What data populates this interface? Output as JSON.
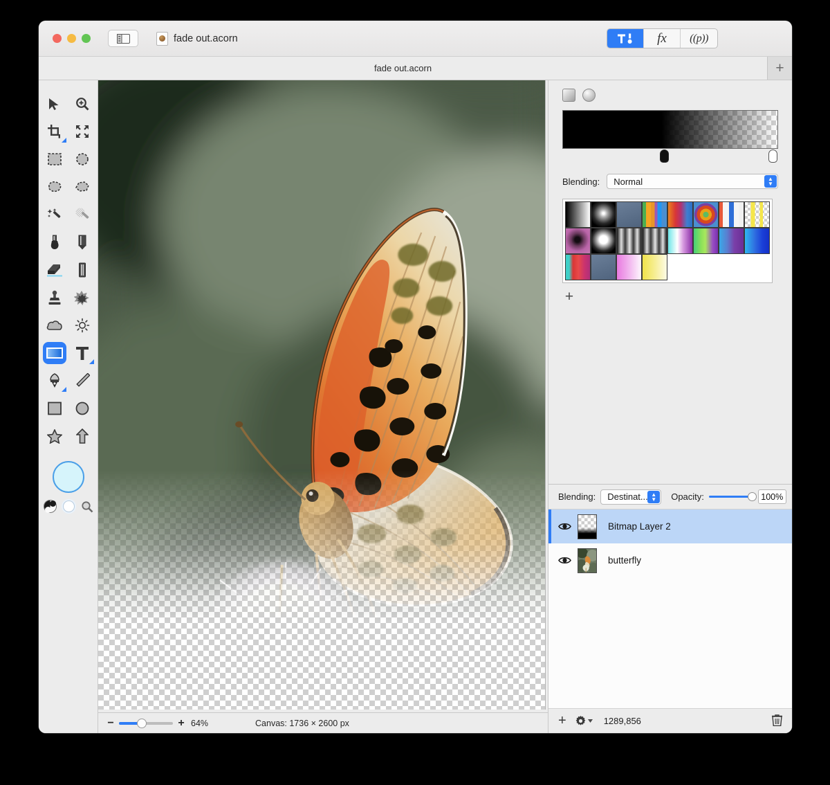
{
  "window": {
    "title": "fade out.acorn",
    "doc_icon": "acorn-document-icon",
    "traffic_lights": [
      "close",
      "minimize",
      "zoom"
    ]
  },
  "titlebar": {
    "sidebar_toggle_icon": "sidebar-toggle-icon",
    "buttons": [
      {
        "name": "tools-palette-button",
        "label": "",
        "icon": "hammer-brush-icon",
        "active": true
      },
      {
        "name": "filters-button",
        "label": "fx",
        "icon": "fx-icon",
        "active": false
      },
      {
        "name": "presets-button",
        "label": "((p))",
        "icon": "presets-icon",
        "active": false
      }
    ]
  },
  "tabbar": {
    "tab_label": "fade out.acorn",
    "new_tab_label": "+"
  },
  "tools": {
    "items": [
      {
        "name": "move-tool",
        "icon": "arrow-cursor-icon",
        "selected": false
      },
      {
        "name": "zoom-tool",
        "icon": "magnifier-plus-icon",
        "selected": false
      },
      {
        "name": "crop-tool",
        "icon": "crop-icon",
        "selected": false,
        "has_submenu": true
      },
      {
        "name": "transform-tool",
        "icon": "move-arrows-icon",
        "selected": false
      },
      {
        "name": "rectangle-select-tool",
        "icon": "dashed-rectangle-icon",
        "selected": false
      },
      {
        "name": "ellipse-select-tool",
        "icon": "dashed-ellipse-icon",
        "selected": false
      },
      {
        "name": "lasso-tool",
        "icon": "lasso-icon",
        "selected": false
      },
      {
        "name": "polygon-lasso-tool",
        "icon": "polygon-lasso-icon",
        "selected": false
      },
      {
        "name": "magic-wand-tool",
        "icon": "magic-wand-icon",
        "selected": false
      },
      {
        "name": "instant-alpha-tool",
        "icon": "instant-alpha-wand-icon",
        "selected": false
      },
      {
        "name": "paintbrush-tool",
        "icon": "paintbrush-icon",
        "selected": false
      },
      {
        "name": "pencil-tool",
        "icon": "pencil-icon",
        "selected": false
      },
      {
        "name": "eraser-tool",
        "icon": "eraser-icon",
        "selected": false
      },
      {
        "name": "marker-tool",
        "icon": "marker-icon",
        "selected": false
      },
      {
        "name": "clone-stamp-tool",
        "icon": "clone-stamp-icon",
        "selected": false
      },
      {
        "name": "smudge-tool",
        "icon": "smudge-splat-icon",
        "selected": false
      },
      {
        "name": "blur-tool",
        "icon": "cloud-blur-icon",
        "selected": false
      },
      {
        "name": "dodge-burn-tool",
        "icon": "sun-dodge-icon",
        "selected": false
      },
      {
        "name": "gradient-tool",
        "icon": "gradient-rectangle-icon",
        "selected": true
      },
      {
        "name": "text-tool",
        "icon": "text-t-icon",
        "selected": false,
        "has_submenu": true
      },
      {
        "name": "bezier-pen-tool",
        "icon": "pen-nib-icon",
        "selected": false,
        "has_submenu": true
      },
      {
        "name": "line-tool",
        "icon": "line-icon",
        "selected": false
      },
      {
        "name": "rectangle-shape-tool",
        "icon": "rectangle-icon",
        "selected": false
      },
      {
        "name": "ellipse-shape-tool",
        "icon": "ellipse-icon",
        "selected": false
      },
      {
        "name": "star-shape-tool",
        "icon": "star-icon",
        "selected": false
      },
      {
        "name": "arrow-shape-tool",
        "icon": "arrow-shape-icon",
        "selected": false
      }
    ],
    "foreground_color": "#d6f4fb",
    "foreground_border": "#4a9fe8",
    "swap_icon": "yin-yang-swap-icon",
    "background_swatch_icon": "background-color-swatch",
    "color_picker_icon": "magnifier-picker-icon"
  },
  "gradient_panel": {
    "shape_buttons": [
      {
        "name": "linear-gradient-shape",
        "icon": "square-gradient-icon"
      },
      {
        "name": "radial-gradient-shape",
        "icon": "circle-gradient-icon"
      }
    ],
    "stops": [
      {
        "position_pct": 47,
        "color": "#000000",
        "selected": true
      },
      {
        "position_pct": 99,
        "color": "#ffffff",
        "selected": false
      }
    ],
    "blending_label": "Blending:",
    "blending_value": "Normal",
    "add_preset_label": "+",
    "presets": [
      "black-to-white-linear",
      "white-radial-glow",
      "steel-blue-linear",
      "rainbow-stripes-on-blue",
      "orange-red-blue-bands",
      "concentric-rainbow-rings",
      "red-white-blue-stripes",
      "yellow-transparent-stripes",
      "pink-black-radial",
      "white-checker-radial",
      "grey-metal-bands",
      "grey-metal-bands-2",
      "cyan-white-purple",
      "green-lime-purple",
      "blue-purple-blend",
      "blue-to-deep-blue",
      "cyan-red-pink",
      "steel-blue-flat",
      "magenta-to-white",
      "yellow-to-white"
    ]
  },
  "layers_panel": {
    "blending_label": "Blending:",
    "blending_value": "Destinat...",
    "opacity_label": "Opacity:",
    "opacity_value": "100%",
    "opacity_pct": 100,
    "layers": [
      {
        "name": "Bitmap Layer 2",
        "visible": true,
        "selected": true,
        "thumbnail": "gradient-fade-thumbnail"
      },
      {
        "name": "butterfly",
        "visible": true,
        "selected": false,
        "thumbnail": "butterfly-photo-thumbnail"
      }
    ],
    "footer": {
      "add_label": "+",
      "gear_icon": "gear-dropdown-icon",
      "count": "1289,856",
      "trash_icon": "trash-icon"
    }
  },
  "statusbar": {
    "zoom_out_label": "−",
    "zoom_in_label": "+",
    "zoom_value": "64%",
    "zoom_pct": 33,
    "canvas_info": "Canvas: 1736 × 2600 px"
  }
}
